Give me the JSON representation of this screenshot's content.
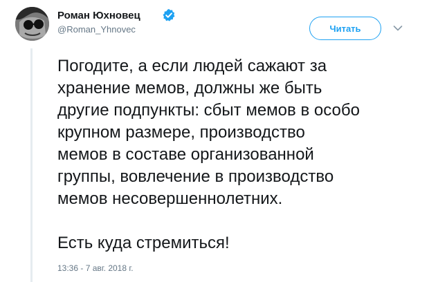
{
  "author": {
    "name": "Роман Юхновец",
    "handle": "@Roman_Yhnovec",
    "verified": true,
    "avatar_icon": "avatar-photo"
  },
  "follow_button": {
    "label": "Читать"
  },
  "menu": {
    "icon": "chevron-down-icon"
  },
  "tweet": {
    "lines": [
      "Погодите, а если людей сажают за",
      "хранение мемов, должны же быть",
      "другие подпункты: сбыт мемов в особо",
      "крупном размере, производство",
      "мемов в составе организованной",
      "группы, вовлечение в производство",
      "мемов несовершеннолетних."
    ],
    "closing": "Есть куда стремиться!",
    "timestamp": "13:36 - 7 авг. 2018 г."
  },
  "colors": {
    "accent": "#1da1f2",
    "text": "#14171a",
    "secondary": "#657786",
    "thread_line": "#e6ecf0"
  }
}
